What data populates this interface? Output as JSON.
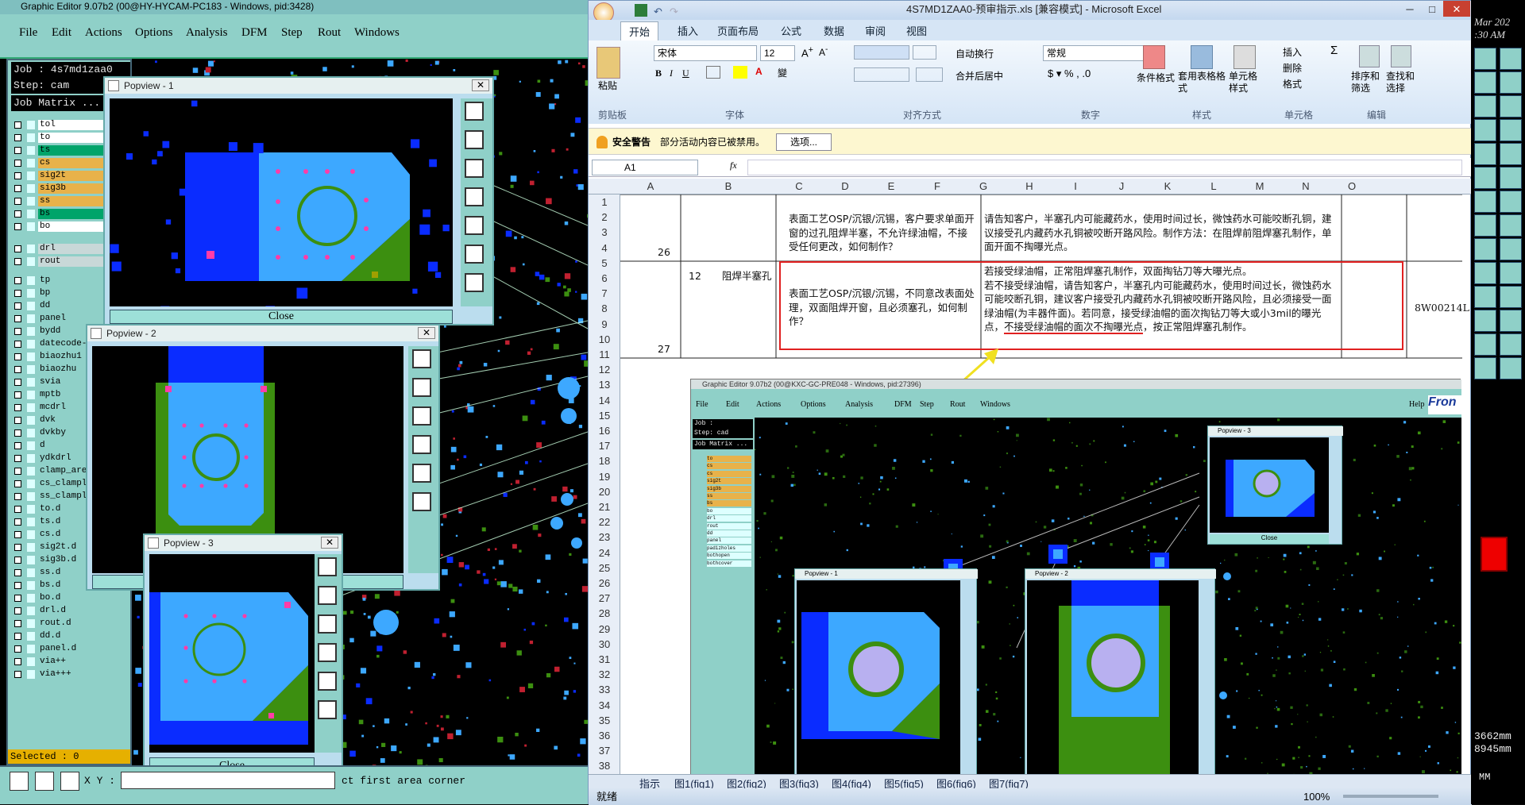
{
  "graphic_editor": {
    "title": "Graphic Editor 9.07b2 (00@HY-HYCAM-PC183 - Windows, pid:3428)",
    "menu": [
      "File",
      "Edit",
      "Actions",
      "Options",
      "Analysis",
      "DFM",
      "Step",
      "Rout",
      "Windows"
    ],
    "job_label": "Job : 4s7md1zaa0",
    "step_label": "Step: cam",
    "matrix_label": "Job Matrix ...",
    "layers": [
      {
        "name": "tol",
        "color": "#ffffff"
      },
      {
        "name": "to",
        "color": "#ffffff"
      },
      {
        "name": "ts",
        "color": "#00a46a"
      },
      {
        "name": "cs",
        "color": "#e8b24a"
      },
      {
        "name": "sig2t",
        "color": "#e8b24a"
      },
      {
        "name": "sig3b",
        "color": "#e8b24a"
      },
      {
        "name": "ss",
        "color": "#e8b24a"
      },
      {
        "name": "bs",
        "color": "#00a46a"
      },
      {
        "name": "bo",
        "color": "#ffffff"
      },
      {
        "name": "drl",
        "color": "#c8d8d8"
      },
      {
        "name": "rout",
        "color": "#c8d8d8"
      },
      {
        "name": "tp",
        "color": "#8fd0c8"
      },
      {
        "name": "bp",
        "color": "#8fd0c8"
      },
      {
        "name": "dd",
        "color": "#8fd0c8"
      },
      {
        "name": "panel",
        "color": "#8fd0c8"
      },
      {
        "name": "bydd",
        "color": "#8fd0c8"
      },
      {
        "name": "datecode-pt",
        "color": "#8fd0c8"
      },
      {
        "name": "biaozhu1",
        "color": "#8fd0c8"
      },
      {
        "name": "biaozhu",
        "color": "#8fd0c8"
      },
      {
        "name": "svia",
        "color": "#8fd0c8"
      },
      {
        "name": "mptb",
        "color": "#8fd0c8"
      },
      {
        "name": "mcdrl",
        "color": "#8fd0c8"
      },
      {
        "name": "dvk",
        "color": "#8fd0c8"
      },
      {
        "name": "dvkby",
        "color": "#8fd0c8"
      },
      {
        "name": "d",
        "color": "#8fd0c8"
      },
      {
        "name": "ydkdrl",
        "color": "#8fd0c8"
      },
      {
        "name": "clamp_area",
        "color": "#8fd0c8"
      },
      {
        "name": "cs_clamplin",
        "color": "#8fd0c8"
      },
      {
        "name": "ss_clamplin",
        "color": "#8fd0c8"
      },
      {
        "name": "to.d",
        "color": "#8fd0c8"
      },
      {
        "name": "ts.d",
        "color": "#8fd0c8"
      },
      {
        "name": "cs.d",
        "color": "#8fd0c8"
      },
      {
        "name": "sig2t.d",
        "color": "#8fd0c8"
      },
      {
        "name": "sig3b.d",
        "color": "#8fd0c8"
      },
      {
        "name": "ss.d",
        "color": "#8fd0c8"
      },
      {
        "name": "bs.d",
        "color": "#8fd0c8"
      },
      {
        "name": "bo.d",
        "color": "#8fd0c8"
      },
      {
        "name": "drl.d",
        "color": "#8fd0c8"
      },
      {
        "name": "rout.d",
        "color": "#8fd0c8"
      },
      {
        "name": "dd.d",
        "color": "#8fd0c8"
      },
      {
        "name": "panel.d",
        "color": "#8fd0c8"
      },
      {
        "name": "via++",
        "color": "#8fd0c8"
      },
      {
        "name": "via+++",
        "color": "#8fd0c8"
      }
    ],
    "selected": "Selected : 0",
    "xy_label": "X Y :",
    "status_msg": "ct first area corner",
    "popviews": [
      {
        "title": "Popview - 1",
        "close": "Close"
      },
      {
        "title": "Popview - 2",
        "close": "Close"
      },
      {
        "title": "Popview - 3",
        "close": "Close"
      }
    ]
  },
  "excel": {
    "title": "4S7MD1ZAA0-预审指示.xls [兼容模式] - Microsoft Excel",
    "tabs": [
      "开始",
      "插入",
      "页面布局",
      "公式",
      "数据",
      "审阅",
      "视图"
    ],
    "font_name": "宋体",
    "font_size": "12",
    "number_format": "常规",
    "ribbon_buttons": {
      "paste": "粘贴",
      "wrap": "自动换行",
      "merge": "合并后居中",
      "cond_format": "条件格式",
      "table_format": "套用表格格式",
      "cell_style": "单元格样式",
      "insert": "插入",
      "delete": "删除",
      "format": "格式",
      "sort": "排序和筛选",
      "find": "查找和选择"
    },
    "group_labels": [
      "剪贴板",
      "字体",
      "对齐方式",
      "数字",
      "样式",
      "单元格",
      "编辑"
    ],
    "security_title": "安全警告",
    "security_msg": "部分活动内容已被禁用。",
    "security_btn": "选项...",
    "name_box": "A1",
    "fx": "fx",
    "columns": [
      "A",
      "B",
      "C",
      "D",
      "E",
      "F",
      "G",
      "H",
      "I",
      "J",
      "K",
      "L",
      "M",
      "N",
      "O"
    ],
    "rows": [
      "1",
      "2",
      "3",
      "4",
      "5",
      "6",
      "7",
      "8",
      "9",
      "10",
      "11",
      "12",
      "13",
      "14",
      "15",
      "16",
      "17",
      "18",
      "19",
      "20",
      "21",
      "22",
      "23",
      "24",
      "25",
      "26",
      "27",
      "28",
      "29",
      "30",
      "31",
      "32",
      "33",
      "34",
      "35",
      "36",
      "37",
      "38"
    ],
    "row26": {
      "num": "26",
      "question": "表面工艺OSP/沉银/沉锡，客户要求单面开窗的过孔阻焊半塞，不允许绿油帽，不接受任何更改，如何制作？",
      "answer": "请告知客户，半塞孔内可能藏药水，使用时间过长，微蚀药水可能咬断孔铜，建议接受孔内藏药水孔铜被咬断开路风险。制作方法：在阻焊前阻焊塞孔制作，单面开面不掏曝光点。"
    },
    "row27": {
      "num": "27",
      "idx": "12",
      "category": "阻焊半塞孔",
      "question": "表面工艺OSP/沉银/沉锡，不同意改表面处理，双面阻焊开窗，且必须塞孔，如何制作？",
      "answer_line1": "若接受绿油帽，正常阻焊塞孔制作，双面掏钻刀等大曝光点。",
      "answer_rest": "若不接受绿油帽，请告知客户，半塞孔内可能藏药水，使用时间过长，微蚀药水可能咬断孔铜，建议客户接受孔内藏药水孔铜被咬断开路风险，且必须接受一面绿油帽(为丰器件面)。若同意，接受绿油帽的面次掏钻刀等大或小3mil的曝光点，",
      "answer_underlined": "不接受绿油帽的面次不掏曝光点",
      "answer_tail": "，按正常阻焊塞孔制作。",
      "code": "8W00214L"
    },
    "embedded": {
      "title": "Graphic Editor 9.07b2 (00@KXC-GC-PRE048 - Windows, pid:27396)",
      "menu": [
        "File",
        "Edit",
        "Actions",
        "Options",
        "Analysis",
        "DFM",
        "Step",
        "Rout",
        "Windows"
      ],
      "help": "Help",
      "brand": "Fron",
      "job": "Job : 4s7md1zaa0",
      "step": "Step: cad",
      "matrix": "Job Matrix ...",
      "layers": [
        "to",
        "cs",
        "cs",
        "sig2t",
        "sig3b",
        "ss",
        "bs",
        "bo",
        "drl",
        "rout",
        "dd",
        "panel",
        "padizholes",
        "bothopen",
        "bothcover"
      ],
      "popviews": [
        "Popview - 1",
        "Popview - 2",
        "Popview - 3"
      ],
      "close": "Close"
    },
    "sheet_tabs": [
      "指示",
      "图1(fig1)",
      "图2(fig2)",
      "图3(fig3)",
      "图4(fig4)",
      "图5(fig5)",
      "图6(fig6)",
      "图7(fig7)"
    ],
    "status_ready": "就绪",
    "zoom": "100%"
  },
  "right_strip": {
    "date": "Mar 202",
    "time": ":30 AM",
    "coord1": "3662mm",
    "coord2": "8945mm",
    "unit": "MM"
  },
  "colors": {
    "pcb_blue": "#0a2cff",
    "pcb_light_blue": "#3da8ff",
    "pcb_green": "#3c8f10",
    "annotation_red": "#e02020",
    "arrow_yellow": "#f0e020"
  }
}
